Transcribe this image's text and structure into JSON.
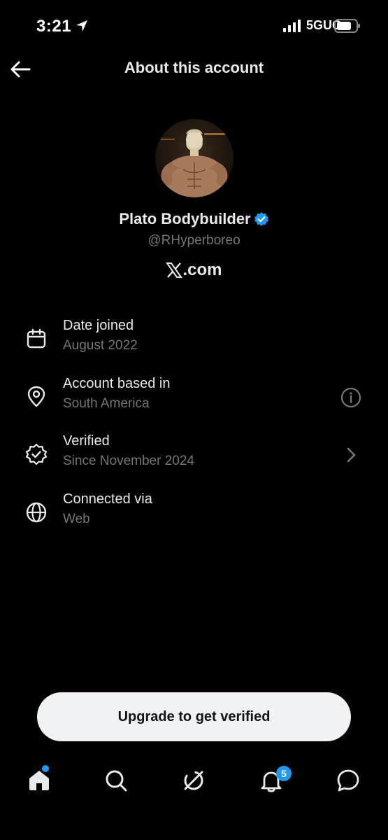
{
  "status_bar": {
    "time": "3:21",
    "network": "5GUC"
  },
  "header": {
    "title": "About this account"
  },
  "profile": {
    "display_name": "Plato Bodybuilder",
    "handle": "@RHyperboreo",
    "site": ".com"
  },
  "info": [
    {
      "label": "Date joined",
      "value": "August 2022",
      "icon": "calendar-icon"
    },
    {
      "label": "Account based in",
      "value": "South America",
      "icon": "location-pin-icon"
    },
    {
      "label": "Verified",
      "value": "Since November 2024",
      "icon": "verified-badge-icon"
    },
    {
      "label": "Connected via",
      "value": "Web",
      "icon": "globe-icon"
    }
  ],
  "upgrade": {
    "label": "Upgrade to get verified"
  },
  "nav": {
    "notifications_count": "5"
  },
  "colors": {
    "accent": "#1d9bf0",
    "background": "#000000",
    "muted": "#71767b",
    "text": "#e7e9ea"
  }
}
